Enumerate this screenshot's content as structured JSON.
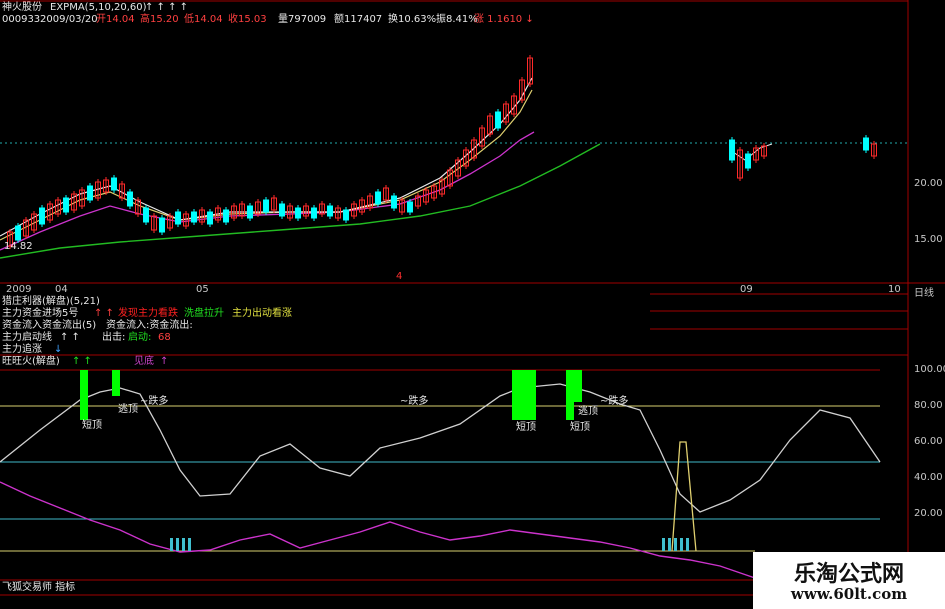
{
  "header": {
    "stock_name": "神火股份",
    "indicator": "EXPMA(5,10,20,60)",
    "arrows": "↑ ↑ ↑ ↑",
    "code": "000933",
    "date": "2009/03/20",
    "open": "开14.04",
    "high": "高15.20",
    "low": "低14.04",
    "close": "收15.03",
    "volume": "量797009",
    "amount": "额117407",
    "turnover": "换10.63%",
    "amplitude": "振8.41%",
    "change": "涨 1.1610 ↓"
  },
  "price_axis": {
    "ticks": [
      "20.00",
      "15.00"
    ],
    "min_price_label": "14.82"
  },
  "date_axis": {
    "labels": [
      "2009",
      "04",
      "05",
      "09",
      "10"
    ],
    "unit": "日线",
    "center_marker": "4"
  },
  "sub_panel": {
    "title": "猎庄利器(解盘)(5,21)",
    "line1_a": "主力资金进场5号",
    "line1_arrows": "↑ ↑",
    "line1_b": "发现主力看跌",
    "line1_c": "洗盘拉升",
    "line1_d": "主力出动看涨",
    "line2_a": "资金流入资金流出(5)",
    "line2_b": "资金流入:资金流出:",
    "line3_a": "主力启动线",
    "line3_arrows": "↑ ↑",
    "line3_b": "出击:",
    "line3_c": "启动:",
    "line3_d": "68",
    "line4": "主力追涨",
    "line4_arrow": "↓"
  },
  "lower_panel": {
    "title": "旺旺火(解盘)",
    "arrows": "↑ ↑",
    "right_label": "见底",
    "right_arrow": "↑",
    "ticks": [
      "100.00",
      "80.00",
      "60.00",
      "40.00",
      "20.00"
    ],
    "labels": {
      "short1": "短顶",
      "escape1": "逃顶",
      "bull1": "~跌多",
      "bull2": "~跌多",
      "short2": "短顶",
      "short3": "短顶",
      "escape2": "逃顶",
      "bull3": "~跌多"
    }
  },
  "footer": {
    "label": "飞狐交易师 指标"
  },
  "watermark": {
    "title": "乐淘公式网",
    "url": "www.60lt.com"
  },
  "colors": {
    "up": "#ff2a2a",
    "down": "#00ffff",
    "ma_white": "#e8e8e8",
    "ma_yellow": "#e0d070",
    "ma_magenta": "#cc33cc",
    "ma_green": "#22bb22",
    "bar_green": "#00ff00"
  }
}
